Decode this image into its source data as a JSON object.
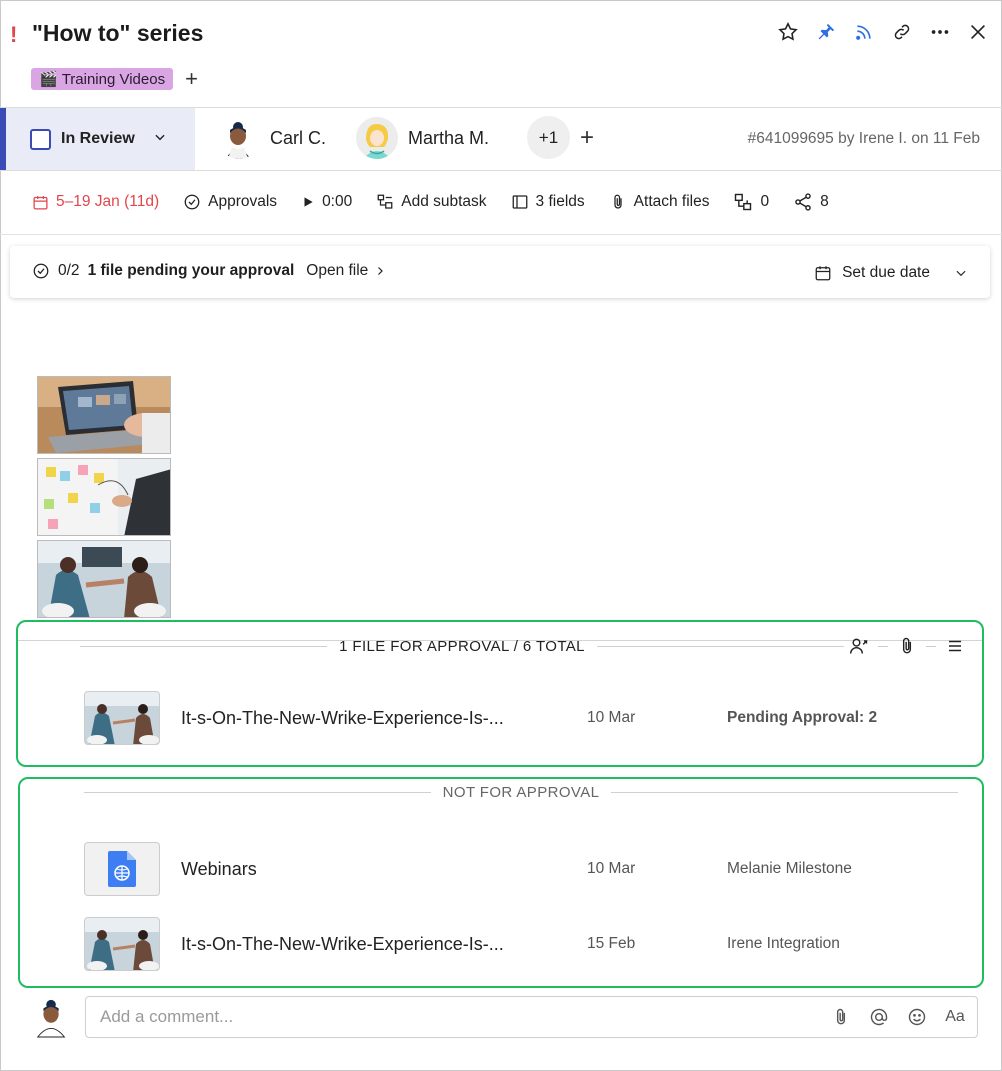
{
  "header": {
    "priority_mark": "!",
    "title": "\"How to\" series",
    "tag_label": "Training Videos",
    "tag_emoji": "🎬",
    "add_tag_label": "+"
  },
  "status": {
    "label": "In Review",
    "assignees": [
      {
        "name": "Carl C."
      },
      {
        "name": "Martha M."
      }
    ],
    "more_count": "+1",
    "add_label": "+",
    "task_id": "#641099695 by Irene I. on 11 Feb"
  },
  "toolbar": {
    "dates": "5–19 Jan (11d)",
    "approvals": "Approvals",
    "timer": "0:00",
    "add_subtask": "Add subtask",
    "fields": "3 fields",
    "attach": "Attach files",
    "dependencies": "0",
    "shares": "8"
  },
  "approval_card": {
    "count": "0/2",
    "message": "1 file pending your approval",
    "open_file": "Open file",
    "set_due_date": "Set due date"
  },
  "for_approval": {
    "title": "1 FILE FOR APPROVAL / 6 TOTAL",
    "files": [
      {
        "name": "It-s-On-The-New-Wrike-Experience-Is-...",
        "date": "10 Mar",
        "meta": "Pending Approval: 2"
      }
    ]
  },
  "not_for_approval": {
    "title": "NOT FOR APPROVAL",
    "files": [
      {
        "name": "Webinars",
        "date": "10 Mar",
        "meta": "Melanie Milestone"
      },
      {
        "name": "It-s-On-The-New-Wrike-Experience-Is-...",
        "date": "15 Feb",
        "meta": "Irene Integration"
      }
    ]
  },
  "comment": {
    "placeholder": "Add a comment...",
    "format_label": "Aa"
  },
  "colors": {
    "accent": "#3a4bb5",
    "danger": "#e0474c",
    "highlight": "#1fbd5f",
    "tag_bg": "#d9a6e3"
  }
}
